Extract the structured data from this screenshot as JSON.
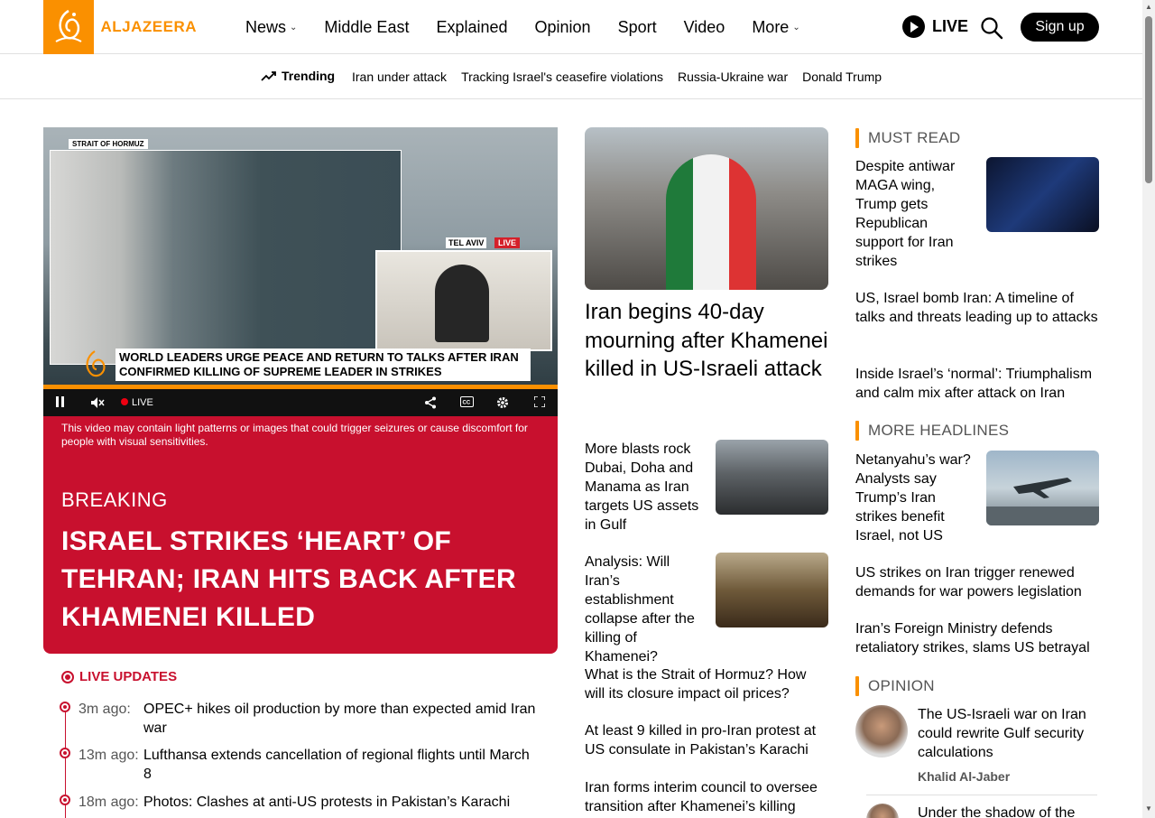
{
  "header": {
    "logo_text": "ALJAZEERA",
    "nav": [
      {
        "label": "News",
        "has_dropdown": true
      },
      {
        "label": "Middle East",
        "has_dropdown": false
      },
      {
        "label": "Explained",
        "has_dropdown": false
      },
      {
        "label": "Opinion",
        "has_dropdown": false
      },
      {
        "label": "Sport",
        "has_dropdown": false
      },
      {
        "label": "Video",
        "has_dropdown": false
      },
      {
        "label": "More",
        "has_dropdown": true
      }
    ],
    "live_label": "LIVE",
    "signup_label": "Sign up"
  },
  "trending": {
    "label": "Trending",
    "links": [
      "Iran under attack",
      "Tracking Israel's ceasefire violations",
      "Russia-Ukraine war",
      "Donald Trump"
    ]
  },
  "video": {
    "corner_tag": "STRAIT OF HORMUZ",
    "location_tag": "TEL AVIV",
    "live_tag": "LIVE",
    "lower_third": "WORLD LEADERS URGE PEACE AND RETURN TO TALKS AFTER IRAN CONFIRMED KILLING OF SUPREME LEADER IN STRIKES",
    "controls_live": "LIVE",
    "warning": "This video may contain light patterns or images that could trigger seizures or cause discomfort for people with visual sensitivities."
  },
  "breaking": {
    "label": "BREAKING",
    "headline": "ISRAEL STRIKES ‘HEART’ OF TEHRAN; IRAN HITS BACK AFTER KHAMENEI KILLED"
  },
  "live_updates": {
    "title": "LIVE UPDATES",
    "items": [
      {
        "time": "3m ago:",
        "text": "OPEC+ hikes oil production by more than expected amid Iran war"
      },
      {
        "time": "13m ago:",
        "text": "Lufthansa extends cancellation of regional flights until March 8"
      },
      {
        "time": "18m ago:",
        "text": "Photos: Clashes at anti-US protests in Pakistan’s Karachi"
      }
    ]
  },
  "middle": {
    "lead_headline": "Iran begins 40-day mourning after Khamenei killed in US-Israeli attack",
    "stories": [
      "More blasts rock Dubai, Doha and Manama as Iran targets US assets in Gulf",
      "Analysis: Will Iran’s establishment collapse after the killing of Khamenei?"
    ],
    "list": [
      "What is the Strait of Hormuz? How will its closure impact oil prices?",
      "At least 9 killed in pro-Iran protest at US consulate in Pakistan’s Karachi",
      "Iran forms interim council to oversee transition after Khamenei’s killing"
    ]
  },
  "right": {
    "must_read_title": "MUST READ",
    "must_read": [
      "Despite antiwar MAGA wing, Trump gets Republican support for Iran strikes",
      "US, Israel bomb Iran: A timeline of talks and threats leading up to attacks",
      "Inside Israel’s ‘normal’: Triumphalism and calm mix after attack on Iran"
    ],
    "more_headlines_title": "MORE HEADLINES",
    "more_headlines": [
      "Netanyahu’s war? Analysts say Trump’s Iran strikes benefit Israel, not US",
      "US strikes on Iran trigger renewed demands for war powers legislation",
      "Iran’s Foreign Ministry defends retaliatory strikes, slams US betrayal"
    ],
    "opinion_title": "OPINION",
    "opinion": [
      {
        "headline": "The US-Israeli war on Iran could rewrite Gulf security calculations",
        "author": "Khalid Al-Jaber"
      },
      {
        "headline": "Under the shadow of the",
        "author": ""
      }
    ]
  },
  "colors": {
    "brand_orange": "#fa9000",
    "breaking_red": "#c8102e"
  }
}
